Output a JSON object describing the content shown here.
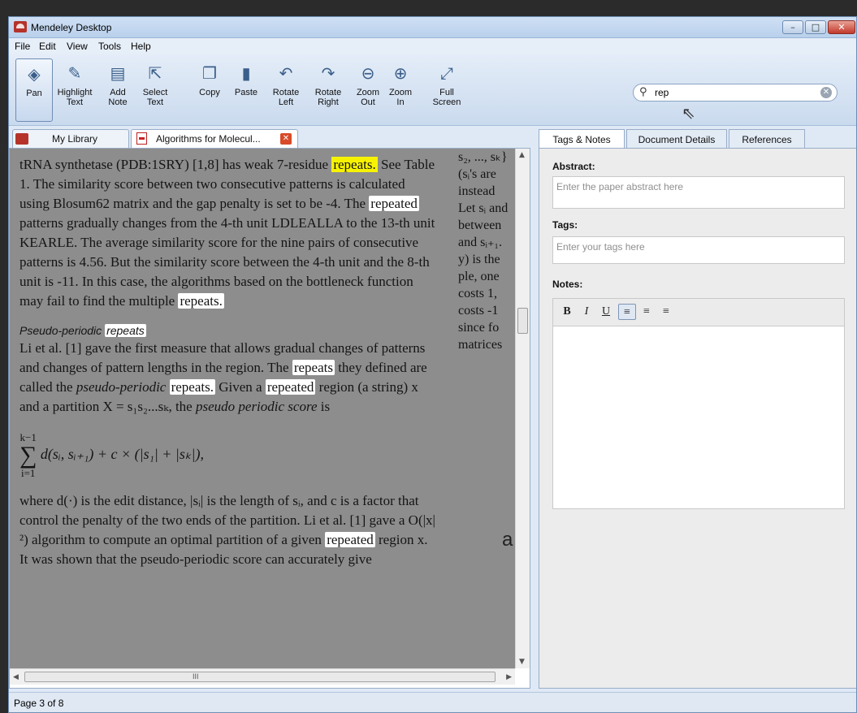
{
  "window": {
    "title": "Mendeley Desktop",
    "min_glyph": "–",
    "max_glyph": "□",
    "close_glyph": "✕"
  },
  "menu": [
    "File",
    "Edit",
    "View",
    "Tools",
    "Help"
  ],
  "toolbar": {
    "pan": {
      "line1": "Pan",
      "line2": "",
      "icon": "◈"
    },
    "highlight": {
      "line1": "Highlight",
      "line2": "Text",
      "icon": "✎"
    },
    "add_note": {
      "line1": "Add",
      "line2": "Note",
      "icon": "▤"
    },
    "select": {
      "line1": "Select",
      "line2": "Text",
      "icon": "⇱"
    },
    "copy": {
      "line1": "Copy",
      "line2": "",
      "icon": "❐"
    },
    "paste": {
      "line1": "Paste",
      "line2": "",
      "icon": "▮"
    },
    "rotate_left": {
      "line1": "Rotate",
      "line2": "Left",
      "icon": "↶"
    },
    "rotate_right": {
      "line1": "Rotate",
      "line2": "Right",
      "icon": "↷"
    },
    "zoom_out": {
      "line1": "Zoom",
      "line2": "Out",
      "icon": "⊖"
    },
    "zoom_in": {
      "line1": "Zoom",
      "line2": "In",
      "icon": "⊕"
    },
    "full_screen": {
      "line1": "Full",
      "line2": "Screen",
      "icon": "⤢"
    }
  },
  "search": {
    "value": "rep",
    "icon": "⚲",
    "clear": "✕"
  },
  "doc_tabs": {
    "library": "My Library",
    "document": "Algorithms for Molecul...",
    "close": "✕"
  },
  "document": {
    "col1": {
      "p1": {
        "a": "tRNA synthetase (PDB:1SRY) [1,8] has weak 7-residue ",
        "hl1": "repeats.",
        "b": " See Table 1. The similarity score between two consecutive patterns is calculated using Blosum62 matrix and the gap penalty is set to be -4. The ",
        "hl2": "repeated",
        "c": " patterns gradually changes from the 4-th unit LDLEALLA to the 13-th unit KEARLE. The average similarity score for the nine pairs of consecutive patterns is 4.56. But the similarity score between the 4-th unit and the 8-th unit is -11. In this case, the algorithms based on the bottleneck function may fail to find the multiple ",
        "hl3": "repeats."
      },
      "heading": {
        "a": "Pseudo-periodic ",
        "hl": "repeats"
      },
      "p2": {
        "a": "Li et al. [1] gave the first measure that allows gradual changes of patterns and changes of pattern lengths in the region. The ",
        "hl1": "repeats",
        "b": " they defined are called the ",
        "it1": "pseudo-periodic",
        "c": " ",
        "hl2": "repeats.",
        "d": " Given a ",
        "hl3": "repeated",
        "e": " region (a string) x and a partition X = s₁s₂...sₖ, the ",
        "it2": "pseudo periodic score",
        "f": " is"
      },
      "formula": {
        "upper": "k−1",
        "sigma": "∑",
        "lower": "i=1",
        "body": "d(sᵢ, sᵢ₊₁) + c × (|s₁| + |sₖ|),"
      },
      "p3": {
        "a": "where d(·) is the edit distance, |sᵢ| is the length of sᵢ, and c is a factor that control the penalty of the two ends of the partition. Li et al. [1] gave a O(|x|²) algorithm to compute an optimal partition of a given ",
        "hl": "repeated",
        "b": " region x. It was shown that the pseudo-periodic score can accurately give"
      }
    },
    "col2_lines": [
      "s₂, ..., sₖ}",
      "(sᵢ's are",
      "instead",
      "Let sᵢ and",
      "between",
      "and sᵢ₊₁.",
      "y) is the",
      "ple, one",
      "costs 1,",
      "costs -1",
      "since fo",
      "matrices"
    ],
    "edge_letter": "a"
  },
  "side_tabs": [
    "Tags & Notes",
    "Document Details",
    "References"
  ],
  "details": {
    "abstract_label": "Abstract:",
    "abstract_placeholder": "Enter the paper abstract here",
    "tags_label": "Tags:",
    "tags_placeholder": "Enter your tags here",
    "notes_label": "Notes:",
    "format_buttons": [
      "B",
      "I",
      "U",
      "≡",
      "≡",
      "≡"
    ]
  },
  "status": {
    "page": "Page 3 of 8"
  },
  "scroll": {
    "up": "▲",
    "down": "▼",
    "left": "◀",
    "right": "▶",
    "grip": "III"
  },
  "colors": {
    "accent": "#3b5f8a",
    "highlight_current": "#f7f300",
    "page_bg": "#8d8d8d"
  }
}
